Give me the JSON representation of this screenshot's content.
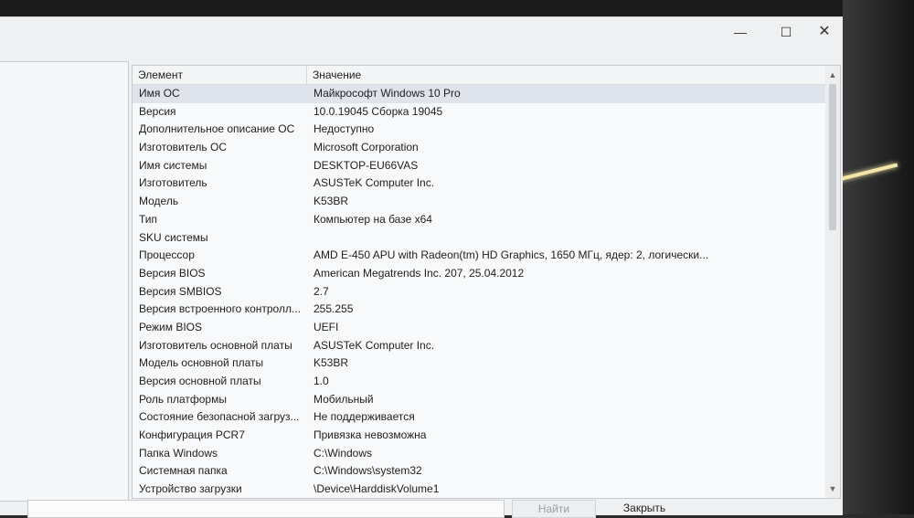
{
  "window": {
    "minimize_glyph": "—",
    "maximize_glyph": "☐",
    "close_glyph": "✕"
  },
  "table": {
    "columns": [
      "Элемент",
      "Значение"
    ],
    "rows": [
      {
        "name": "Имя ОС",
        "value": "Майкрософт Windows 10 Pro"
      },
      {
        "name": "Версия",
        "value": "10.0.19045 Сборка 19045"
      },
      {
        "name": "Дополнительное описание ОС",
        "value": "Недоступно"
      },
      {
        "name": "Изготовитель ОС",
        "value": "Microsoft Corporation"
      },
      {
        "name": "Имя системы",
        "value": "DESKTOP-EU66VAS"
      },
      {
        "name": "Изготовитель",
        "value": "ASUSTeK Computer Inc."
      },
      {
        "name": "Модель",
        "value": "K53BR"
      },
      {
        "name": "Тип",
        "value": "Компьютер на базе x64"
      },
      {
        "name": "SKU системы",
        "value": ""
      },
      {
        "name": "Процессор",
        "value": "AMD E-450 APU with Radeon(tm) HD Graphics, 1650 МГц, ядер: 2, логически..."
      },
      {
        "name": "Версия BIOS",
        "value": "American Megatrends Inc. 207, 25.04.2012"
      },
      {
        "name": "Версия SMBIOS",
        "value": "2.7"
      },
      {
        "name": "Версия встроенного контролл...",
        "value": "255.255"
      },
      {
        "name": "Режим BIOS",
        "value": "UEFI"
      },
      {
        "name": "Изготовитель основной платы",
        "value": "ASUSTeK Computer Inc."
      },
      {
        "name": "Модель основной платы",
        "value": "K53BR"
      },
      {
        "name": "Версия основной платы",
        "value": "1.0"
      },
      {
        "name": "Роль платформы",
        "value": "Мобильный"
      },
      {
        "name": "Состояние безопасной загруз...",
        "value": "Не поддерживается"
      },
      {
        "name": "Конфигурация PCR7",
        "value": "Привязка невозможна"
      },
      {
        "name": "Папка Windows",
        "value": "C:\\Windows"
      },
      {
        "name": "Системная папка",
        "value": "C:\\Windows\\system32"
      },
      {
        "name": "Устройство загрузки",
        "value": "\\Device\\HarddiskVolume1"
      }
    ]
  },
  "footer": {
    "find_label": "Найти",
    "close_label": "Закрыть"
  }
}
